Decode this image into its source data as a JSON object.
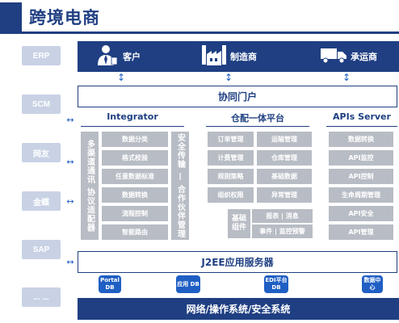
{
  "title": "跨境电商",
  "sidebar": [
    "ERP",
    "SCM",
    "网友",
    "金蝶",
    "SAP",
    "... ..."
  ],
  "actors": {
    "customer": "客户",
    "manufacturer": "制造商",
    "carrier": "承运商"
  },
  "portal": "协同门户",
  "integrator": {
    "title": "Integrator",
    "side_label": "多渠道通讯 协议适配器",
    "items": [
      "数据分类",
      "格式校验",
      "任意数据标准",
      "数据转换",
      "流程控制",
      "智能路由"
    ]
  },
  "security": {
    "label": "安全传输 — 合作伙伴管理"
  },
  "platform": {
    "title": "仓配一体平台",
    "grid": [
      [
        "订单管理",
        "运输管理"
      ],
      [
        "计费管理",
        "仓库管理"
      ],
      [
        "规则策略",
        "基础数据"
      ],
      [
        "组织权限",
        "异常管理"
      ]
    ],
    "base_label": "基础组件",
    "base_items": [
      "报表 | 消息",
      "事件 | 监控预警"
    ]
  },
  "apis": {
    "title": "APIs Server",
    "items": [
      "数据转换",
      "API监控",
      "API控制",
      "生命周期管理",
      "API安全",
      "API管理"
    ]
  },
  "server": "J2EE应用服务器",
  "databases": [
    "Portal DB",
    "应用 DB",
    "EDI平台 DB",
    "数据中心"
  ],
  "bottom": "网络/操作系统/安全系统",
  "colors": {
    "primary": "#1f3f82",
    "accent_blue": "#1f5fc4",
    "gray_box": "#b8bcc4",
    "sidebar_box": "#c9d2e5"
  }
}
